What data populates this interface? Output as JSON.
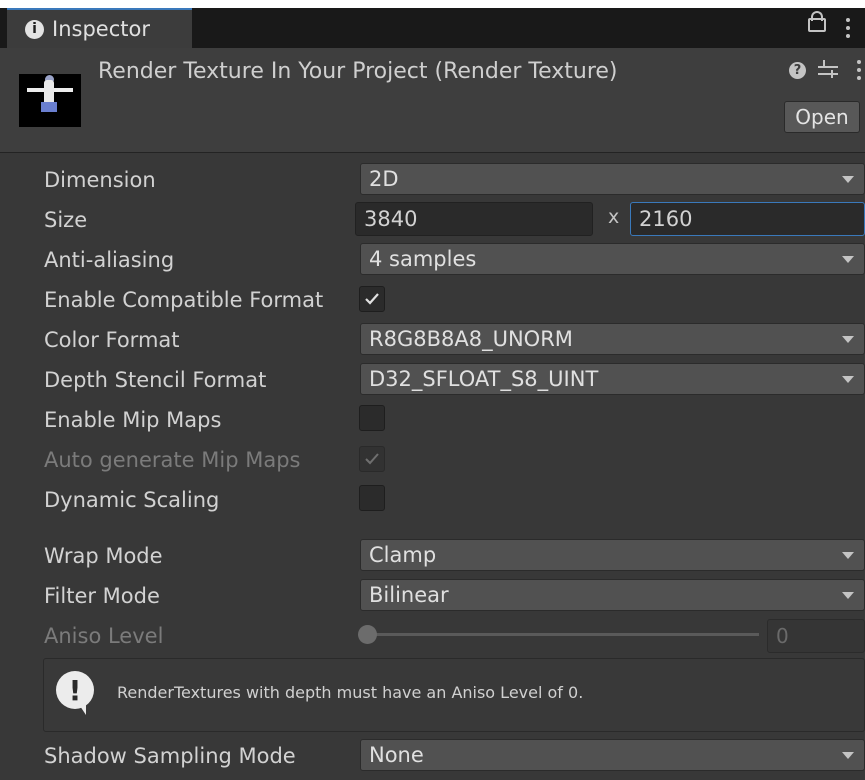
{
  "window": {
    "tab_label": "Inspector",
    "tab_icon": "info-icon"
  },
  "header": {
    "object_title": "Render Texture In Your Project (Render Texture)",
    "open_label": "Open"
  },
  "properties": {
    "dimension": {
      "label": "Dimension",
      "value": "2D"
    },
    "size": {
      "label": "Size",
      "width": "3840",
      "separator": "x",
      "height": "2160"
    },
    "anti_aliasing": {
      "label": "Anti-aliasing",
      "value": "4 samples"
    },
    "enable_compatible_format": {
      "label": "Enable Compatible Format",
      "checked": true
    },
    "color_format": {
      "label": "Color Format",
      "value": "R8G8B8A8_UNORM"
    },
    "depth_stencil_format": {
      "label": "Depth Stencil Format",
      "value": "D32_SFLOAT_S8_UINT"
    },
    "enable_mip_maps": {
      "label": "Enable Mip Maps",
      "checked": false
    },
    "auto_generate_mip_maps": {
      "label": "Auto generate Mip Maps",
      "checked": true,
      "disabled": true
    },
    "dynamic_scaling": {
      "label": "Dynamic Scaling",
      "checked": false
    },
    "wrap_mode": {
      "label": "Wrap Mode",
      "value": "Clamp"
    },
    "filter_mode": {
      "label": "Filter Mode",
      "value": "Bilinear"
    },
    "aniso_level": {
      "label": "Aniso Level",
      "value": "0",
      "disabled": true,
      "fraction": 0
    },
    "shadow_sampling_mode": {
      "label": "Shadow Sampling Mode",
      "value": "None"
    }
  },
  "help_box": {
    "message": "RenderTextures with depth must have an Aniso Level of 0."
  },
  "colors": {
    "background": "#383838",
    "accent": "#3a79bb",
    "field": "#2a2a2a",
    "dropdown": "#515151"
  }
}
